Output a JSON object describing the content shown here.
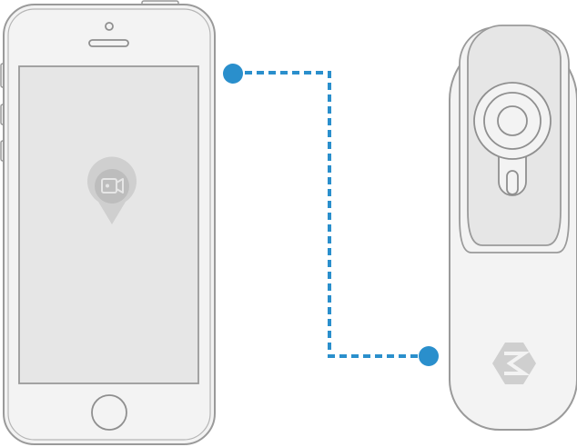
{
  "diagram": {
    "phone": {
      "icon": "video-camera-location-pin-icon",
      "screen_state": "blank"
    },
    "device": {
      "logo_icon": "z-logo-icon",
      "control": "joystick-icon"
    },
    "connection": {
      "style": "dashed",
      "color": "#2a8fcc"
    },
    "colors": {
      "outline": "#9a9a9a",
      "body_fill": "#f3f3f3",
      "screen_fill": "#e6e6e6",
      "logo_fill": "#cfcfcf",
      "accent": "#2a8fcc"
    }
  }
}
